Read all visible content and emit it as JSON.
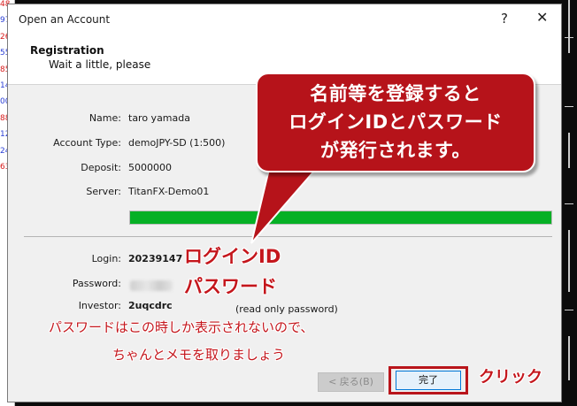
{
  "background": {
    "left_numbers": [
      {
        "text": "48",
        "color": "#d81b1b"
      },
      {
        "text": "97",
        "color": "#2b3fd6"
      },
      {
        "text": "26",
        "color": "#d81b1b"
      },
      {
        "text": "55",
        "color": "#2b3fd6"
      },
      {
        "text": "85",
        "color": "#d81b1b"
      },
      {
        "text": "14",
        "color": "#2b3fd6"
      },
      {
        "text": "00",
        "color": "#2b3fd6"
      },
      {
        "text": "88",
        "color": "#d81b1b"
      },
      {
        "text": "12",
        "color": "#2b3fd6"
      },
      {
        "text": "24",
        "color": "#2b3fd6"
      },
      {
        "text": "63",
        "color": "#d81b1b"
      }
    ]
  },
  "dialog": {
    "title": "Open an Account",
    "help_label": "?",
    "close_label": "✕",
    "header_title": "Registration",
    "header_subtitle": "Wait a little, please",
    "fields": {
      "name_label": "Name:",
      "name_value": "taro yamada",
      "account_type_label": "Account Type:",
      "account_type_value": "demoJPY-SD (1:500)",
      "deposit_label": "Deposit:",
      "deposit_value": "5000000",
      "server_label": "Server:",
      "server_value": "TitanFX-Demo01",
      "login_label": "Login:",
      "login_value": "20239147",
      "password_label": "Password:",
      "investor_label": "Investor:",
      "investor_value": "2uqcdrc",
      "investor_note": "(read only password)"
    },
    "progress": {
      "fraction": 1.0,
      "color": "#06b025"
    },
    "buttons": {
      "back_label": "< 戻る(B)",
      "finish_label": "完了"
    }
  },
  "annotations": {
    "callout_lines": [
      "名前等を登録すると",
      "ログインIDとパスワード",
      "が発行されます。"
    ],
    "login_id": "ログインID",
    "password": "パスワード",
    "note_line1": "パスワードはこの時しか表示されないので、",
    "note_line2": "ちゃんとメモを取りましょう",
    "click": "クリック",
    "accent_color": "#c4161c"
  }
}
